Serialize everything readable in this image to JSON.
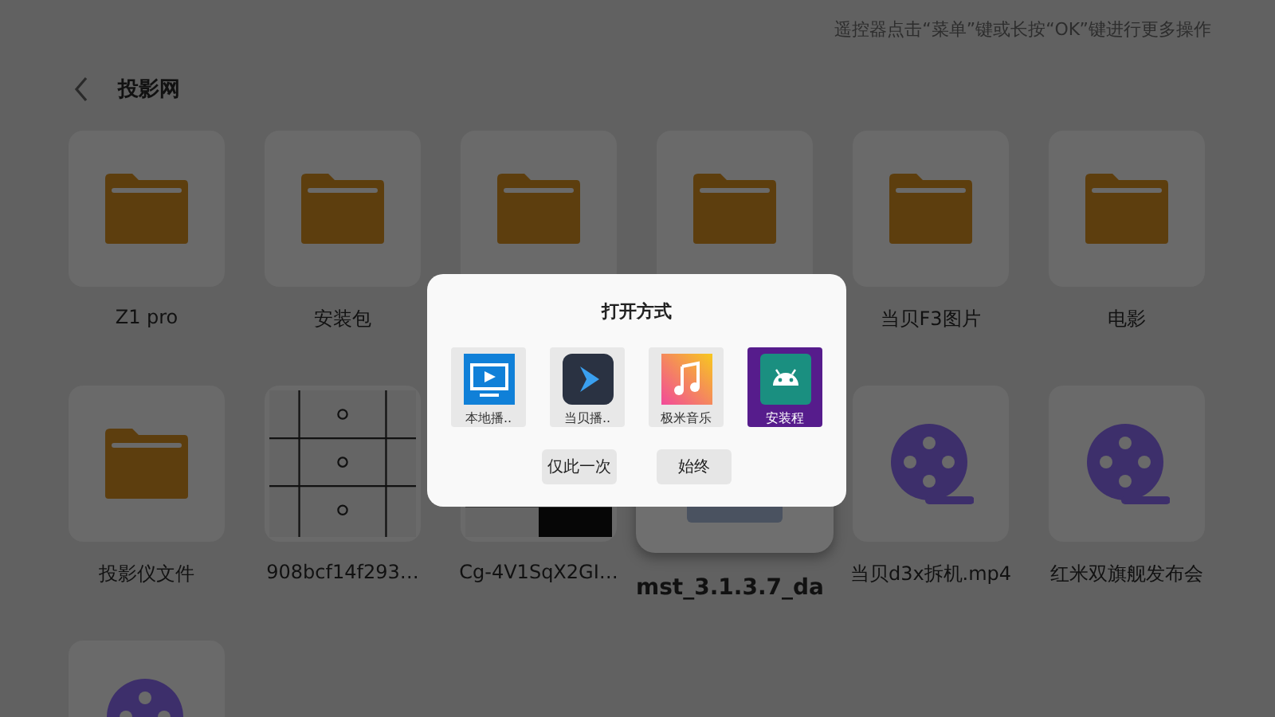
{
  "hint": "遥控器点击“菜单”键或长按“OK”键进行更多操作",
  "header": {
    "back": true,
    "title": "投影网"
  },
  "files": [
    {
      "kind": "folder",
      "name": "Z1 pro",
      "selected": false
    },
    {
      "kind": "folder",
      "name": "安装包",
      "selected": false
    },
    {
      "kind": "folder",
      "selected": false
    },
    {
      "kind": "folder",
      "selected": false
    },
    {
      "kind": "folder",
      "name": "当贝F3图片",
      "selected": false
    },
    {
      "kind": "folder",
      "name": "电影",
      "selected": false
    },
    {
      "kind": "folder",
      "name": "投影仪文件",
      "selected": false
    },
    {
      "kind": "grid-image",
      "name": "908bcf14f293…",
      "selected": false
    },
    {
      "kind": "checker-image",
      "name": "Cg-4V1SqX2GI…",
      "selected": false
    },
    {
      "kind": "package",
      "name": "mst_3.1.3.7_da",
      "selected": true
    },
    {
      "kind": "video",
      "name": "当贝d3x拆机.mp4",
      "selected": false
    },
    {
      "kind": "video",
      "name": "红米双旗舰发布会",
      "selected": false
    },
    {
      "kind": "video",
      "selected": false
    }
  ],
  "dialog": {
    "title": "打开方式",
    "apps": [
      {
        "kind": "tv",
        "label": "本地播..",
        "selected": false
      },
      {
        "kind": "play",
        "label": "当贝播..",
        "selected": false
      },
      {
        "kind": "music",
        "label": "极米音乐",
        "selected": false
      },
      {
        "kind": "android",
        "label": "安装程",
        "selected": true
      }
    ],
    "buttons": [
      "仅此一次",
      "始终"
    ]
  }
}
